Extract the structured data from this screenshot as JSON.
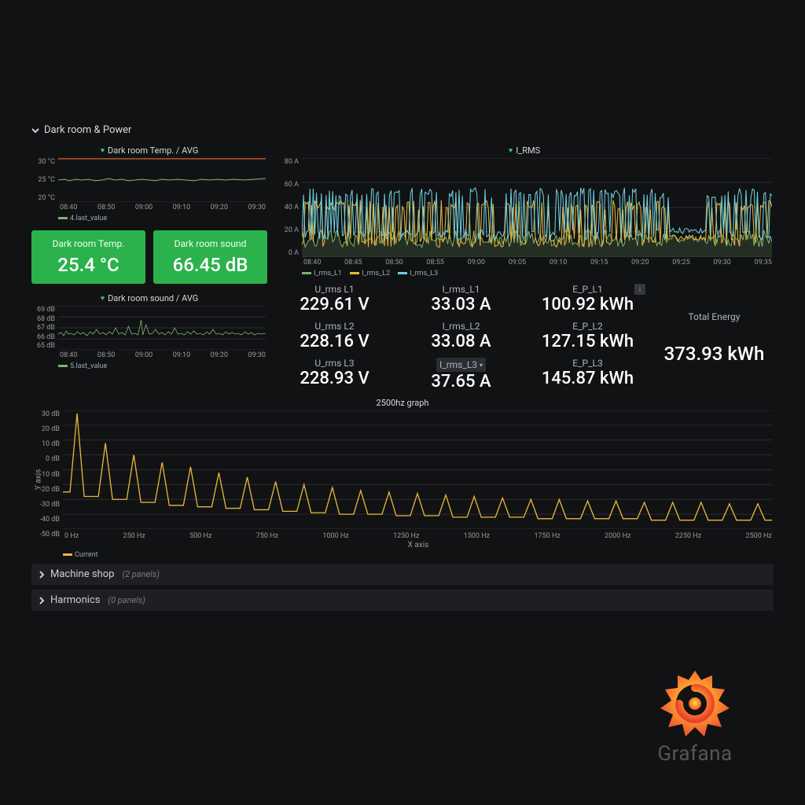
{
  "section": {
    "title": "Dark room & Power"
  },
  "temp_panel": {
    "title": "Dark room Temp. / AVG",
    "legend": "4.last_value",
    "yticks": [
      "30 °C",
      "25 °C",
      "20 °C"
    ],
    "xticks": [
      "08:40",
      "08:50",
      "09:00",
      "09:10",
      "09:20",
      "09:30"
    ]
  },
  "sound_panel": {
    "title": "Dark room sound / AVG",
    "legend": "5.last_value",
    "yticks": [
      "69 dB",
      "68 dB",
      "67 dB",
      "66 dB",
      "65 dB"
    ],
    "xticks": [
      "08:40",
      "08:50",
      "09:00",
      "09:10",
      "09:20",
      "09:30"
    ]
  },
  "green_stats": {
    "temp": {
      "title": "Dark room Temp.",
      "value": "25.4 °C"
    },
    "sound": {
      "title": "Dark room sound",
      "value": "66.45 dB"
    }
  },
  "irms_panel": {
    "title": "I_RMS",
    "yticks": [
      "80 A",
      "60 A",
      "40 A",
      "20 A",
      "0 A"
    ],
    "xticks": [
      "08:40",
      "08:45",
      "08:50",
      "08:55",
      "09:00",
      "09:05",
      "09:10",
      "09:15",
      "09:20",
      "09:25",
      "09:30",
      "09:35"
    ],
    "legends": [
      "I_rms_L1",
      "I_rms_L2",
      "I_rms_L3"
    ]
  },
  "stats": {
    "u_l1": {
      "title": "U_rms L1",
      "value": "229.61 V"
    },
    "i_l1": {
      "title": "I_rms_L1",
      "value": "33.03 A"
    },
    "e_l1": {
      "title": "E_P_L1",
      "value": "100.92 kWh"
    },
    "total": {
      "title": "Total Energy",
      "value": "373.93 kWh"
    },
    "u_l2": {
      "title": "U_rms L2",
      "value": "228.16 V"
    },
    "i_l2": {
      "title": "I_rms_L2",
      "value": "33.08 A"
    },
    "e_l2": {
      "title": "E_P_L2",
      "value": "127.15 kWh"
    },
    "u_l3": {
      "title": "U_rms L3",
      "value": "228.93 V"
    },
    "i_l3": {
      "title": "I_rms_L3",
      "value": "37.65 A"
    },
    "e_l3": {
      "title": "E_P_L3",
      "value": "145.87 kWh"
    }
  },
  "hz_panel": {
    "title": "2500hz graph",
    "ylabel": "Y axis",
    "xlabel": "X axis",
    "legend": "Current",
    "yticks": [
      "30 dB",
      "20 dB",
      "10 dB",
      "0 dB",
      "-10 dB",
      "-20 dB",
      "-30 dB",
      "-40 dB",
      "-50 dB"
    ],
    "xticks": [
      "0 Hz",
      "250 Hz",
      "500 Hz",
      "750 Hz",
      "1000 Hz",
      "1250 Hz",
      "1500 Hz",
      "1750 Hz",
      "2000 Hz",
      "2250 Hz",
      "2500 Hz"
    ]
  },
  "collapsed": {
    "machine": {
      "title": "Machine shop",
      "count": "(2 panels)"
    },
    "harmonics": {
      "title": "Harmonics",
      "count": "(0 panels)"
    }
  },
  "logo_text": "Grafana",
  "chart_data": [
    {
      "type": "line",
      "title": "Dark room Temp. / AVG",
      "series": [
        {
          "name": "4.last_value",
          "approx_mean": 25.3,
          "approx_range": [
            25.0,
            25.7
          ]
        }
      ],
      "threshold": 30,
      "ylim": [
        20,
        30
      ],
      "yunit": "°C",
      "x_timerange": [
        "08:40",
        "09:35"
      ]
    },
    {
      "type": "line",
      "title": "Dark room sound / AVG",
      "series": [
        {
          "name": "5.last_value",
          "approx_mean": 66.5,
          "approx_range": [
            66.0,
            68.5
          ]
        }
      ],
      "ylim": [
        65,
        69
      ],
      "yunit": "dB",
      "x_timerange": [
        "08:40",
        "09:35"
      ]
    },
    {
      "type": "line",
      "title": "I_RMS",
      "series": [
        {
          "name": "I_rms_L1",
          "color": "#7eb26d",
          "approx_range": [
            10,
            20
          ]
        },
        {
          "name": "I_rms_L2",
          "color": "#eab839",
          "approx_range": [
            10,
            45
          ]
        },
        {
          "name": "I_rms_L3",
          "color": "#6ed0e0",
          "approx_range": [
            15,
            55
          ]
        }
      ],
      "ylim": [
        0,
        80
      ],
      "yunit": "A",
      "x_timerange": [
        "08:40",
        "09:37"
      ]
    },
    {
      "type": "line",
      "title": "2500hz graph",
      "xlabel": "X axis",
      "ylabel": "Y axis",
      "series": [
        {
          "name": "Current",
          "color": "#eab839",
          "x_hz": [
            0,
            50,
            100,
            150,
            200,
            250,
            300,
            350,
            400,
            450,
            500,
            550,
            600,
            650,
            700,
            750,
            800,
            850,
            900,
            950,
            1000,
            1050,
            1100,
            1150,
            1200,
            1250,
            1300,
            1350,
            1400,
            1450,
            1500,
            1550,
            1600,
            1650,
            1700,
            1750,
            1800,
            1850,
            1900,
            1950,
            2000,
            2050,
            2100,
            2150,
            2200,
            2250,
            2300,
            2350,
            2400,
            2450,
            2500
          ],
          "y_db": [
            -25,
            28,
            -28,
            8,
            -30,
            0,
            -32,
            -5,
            -34,
            -8,
            -35,
            -12,
            -36,
            -15,
            -37,
            -18,
            -38,
            -20,
            -39,
            -22,
            -40,
            -24,
            -40,
            -25,
            -41,
            -26,
            -41,
            -27,
            -42,
            -28,
            -42,
            -29,
            -42,
            -30,
            -43,
            -30,
            -43,
            -31,
            -43,
            -31,
            -43,
            -32,
            -44,
            -32,
            -44,
            -32,
            -44,
            -33,
            -44,
            -33,
            -44
          ]
        }
      ],
      "ylim": [
        -50,
        30
      ],
      "yunit": "dB",
      "xlim": [
        0,
        2500
      ],
      "xunit": "Hz"
    }
  ]
}
